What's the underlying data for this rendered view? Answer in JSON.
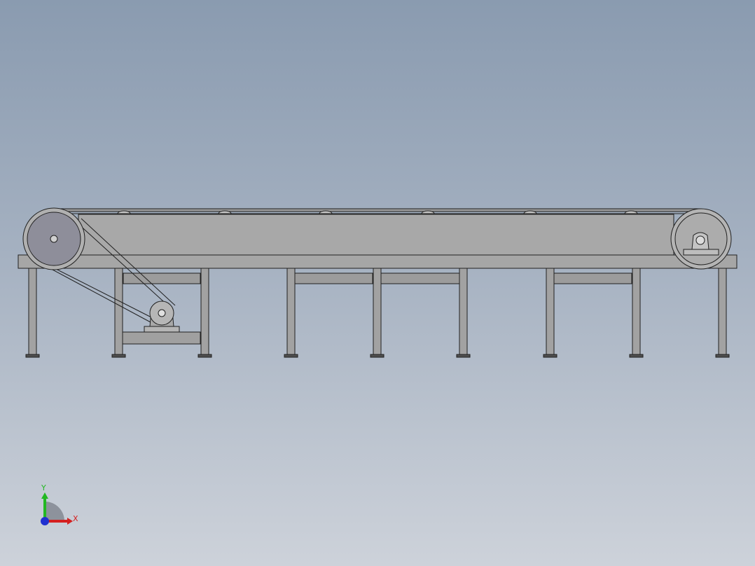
{
  "viewport": {
    "background_top": "#8a9bb0",
    "background_bottom": "#cdd2da"
  },
  "model": {
    "frame_color": "#a8a8a8",
    "edge_color": "#202020",
    "drive_pulley_color": "#8e8e9a",
    "leg_count": 9
  },
  "triad": {
    "x_label": "X",
    "y_label": "Y",
    "x_color": "#d42020",
    "y_color": "#22b822",
    "z_color": "#2030d0"
  }
}
